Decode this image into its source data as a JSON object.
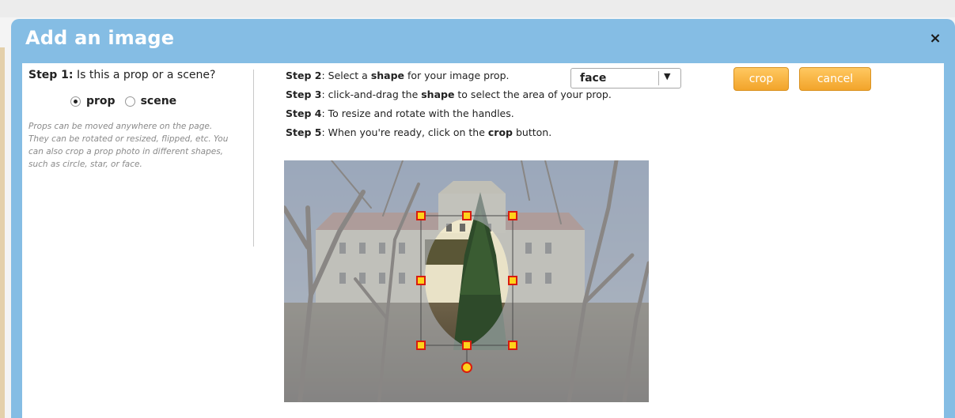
{
  "dialog": {
    "title": "Add an image",
    "close_glyph": "×"
  },
  "step1": {
    "label": "Step 1:",
    "question": "Is this a prop or a scene?",
    "options": [
      {
        "label": "prop",
        "selected": true
      },
      {
        "label": "scene",
        "selected": false
      }
    ],
    "note": "Props can be moved anywhere on the page. They can be rotated or resized, flipped, etc. You can also crop a prop photo in different shapes, such as circle, star, or face."
  },
  "steps": {
    "step2": {
      "label": "Step 2",
      "pre": ": Select a ",
      "bold": "shape",
      "post": " for your image prop."
    },
    "step3": {
      "label": "Step 3",
      "pre": ": click-and-drag the ",
      "bold": "shape",
      "post": " to select the area of your prop."
    },
    "step4": {
      "label": "Step 4",
      "pre": ": To resize and rotate with the handles."
    },
    "step5": {
      "label": "Step 5",
      "pre": ": When you're ready, click on the ",
      "bold": "crop",
      "post": " button."
    }
  },
  "shape_select": {
    "value": "face",
    "arrow_glyph": "▼"
  },
  "buttons": {
    "crop": "crop",
    "cancel": "cancel"
  },
  "colors": {
    "dialog_header": "#85bde4",
    "button_orange": "#f5ae39",
    "handle_fill": "#ffd21a",
    "handle_stroke": "#d81c10"
  },
  "icons": {
    "close": "close-icon",
    "dropdown": "chevron-down-icon",
    "rotate": "rotate-handle-icon",
    "resize": "resize-handle-icon"
  }
}
